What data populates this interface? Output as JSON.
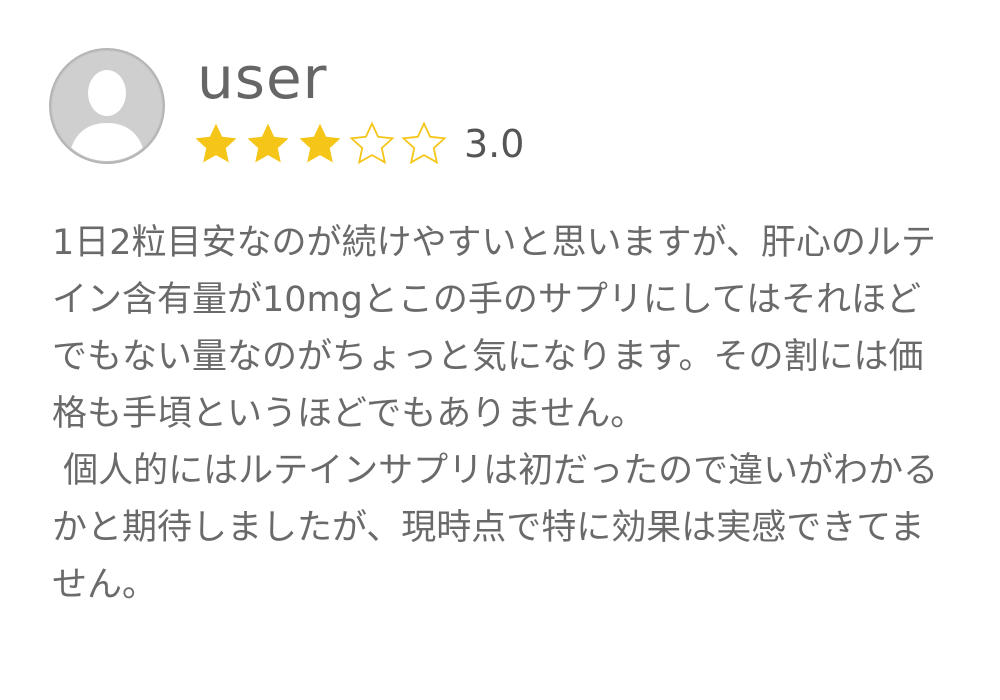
{
  "review": {
    "user_name": "user",
    "rating": {
      "value_text": "3.0",
      "value": 3,
      "max": 5,
      "filled_color": "#F5C518",
      "empty_color": "#F5C518"
    },
    "body_paragraphs": [
      "1日2粒目安なのが続けやすいと思いますが、肝心のルテイン含有量が10mgとこの手のサプリにしてはそれほどでもない量なのがちょっと気になります。その割には価格も手頃というほどでもありません。",
      " 個人的にはルテインサプリは初だったので違いがわかるかと期待しましたが、現時点で特に効果は実感できてません。"
    ]
  },
  "icons": {
    "avatar": "user-silhouette-icon",
    "star_filled": "star-filled-icon",
    "star_empty": "star-outline-icon"
  },
  "colors": {
    "avatar_bg": "#D0D0D0",
    "avatar_ring": "#BDBDBD",
    "avatar_figure": "#FFFFFF",
    "text": "#6A6A6A"
  }
}
